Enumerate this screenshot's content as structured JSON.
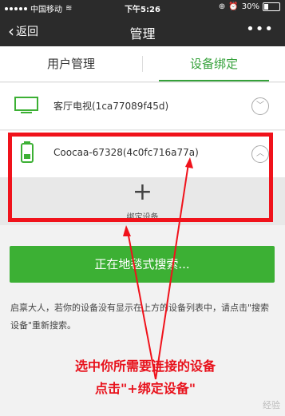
{
  "status_bar": {
    "carrier": "中国移动",
    "time": "下午5:26",
    "battery": "30%",
    "battery_level": 0.3
  },
  "nav": {
    "back_label": "返回",
    "title": "管理",
    "more_label": "•••"
  },
  "tabs": [
    {
      "label": "用户管理"
    },
    {
      "label": "设备绑定"
    }
  ],
  "devices": [
    {
      "name": "客厅电视(1ca77089f45d)",
      "icon": "tv-icon",
      "chevron": "﹀"
    },
    {
      "name": "Coocaa-67328(4c0fc716a77a)",
      "icon": "phone-icon",
      "chevron": "︿"
    }
  ],
  "bind": {
    "label": "绑定设备",
    "plus": "+"
  },
  "search_button": "正在地毯式搜索...",
  "hint_text": "启禀大人，若你的设备没有显示在上方的设备列表中，请点击\"搜索设备\"重新搜索。",
  "annotation": {
    "line1": "选中你所需要连接的设备",
    "line2": "点击\"+绑定设备\""
  },
  "watermark": "经验",
  "colors": {
    "accent": "#35a13a",
    "annotation": "#f0121b"
  }
}
